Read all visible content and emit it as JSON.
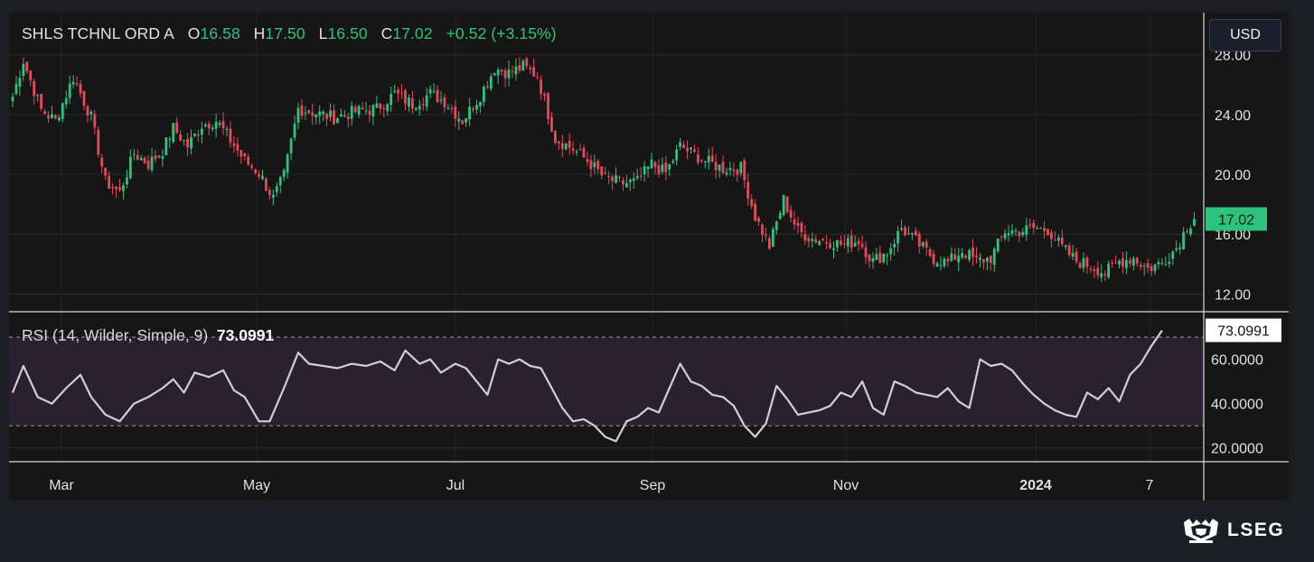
{
  "header": {
    "symbol": "SHLS TCHNL ORD A",
    "open_label": "O",
    "open": "16.58",
    "high_label": "H",
    "high": "17.50",
    "low_label": "L",
    "low": "16.50",
    "close_label": "C",
    "close": "17.02",
    "change": "+0.52 (+3.15%)"
  },
  "currency_button": "USD",
  "rsi_header": {
    "label": "RSI (14, Wilder, Simple, 9)",
    "value": "73.0991"
  },
  "brand": {
    "name": "LSEG"
  },
  "colors": {
    "up": "#2ec27e",
    "down": "#e8485a",
    "background": "#161616",
    "rsi_band": "#2a2130",
    "rsi_line": "#d0d0d0"
  },
  "chart_data": [
    {
      "type": "candlestick",
      "title": "SHLS TCHNL ORD A",
      "ylim": [
        11,
        28.4
      ],
      "yticks": [
        "28.00",
        "24.00",
        "20.00",
        "16.00",
        "12.00"
      ],
      "last_price_label": "17.02",
      "xticks": [
        "Mar",
        "May",
        "Jul",
        "Sep",
        "Nov",
        "2024",
        "7"
      ],
      "anchors": [
        [
          0,
          25.2
        ],
        [
          3,
          27.6
        ],
        [
          8,
          24.3
        ],
        [
          12,
          23.6
        ],
        [
          17,
          26.5
        ],
        [
          22,
          23.8
        ],
        [
          26,
          19.5
        ],
        [
          30,
          18.8
        ],
        [
          34,
          21.4
        ],
        [
          38,
          20.7
        ],
        [
          42,
          21.6
        ],
        [
          45,
          23.1
        ],
        [
          49,
          21.9
        ],
        [
          53,
          23.3
        ],
        [
          57,
          23.6
        ],
        [
          61,
          22.3
        ],
        [
          65,
          20.9
        ],
        [
          69,
          20.1
        ],
        [
          73,
          18.4
        ],
        [
          76,
          19.9
        ],
        [
          80,
          24.4
        ],
        [
          85,
          24.1
        ],
        [
          90,
          23.8
        ],
        [
          96,
          24.2
        ],
        [
          102,
          24.4
        ],
        [
          107,
          25.4
        ],
        [
          112,
          24.7
        ],
        [
          117,
          25.4
        ],
        [
          121,
          24.9
        ],
        [
          126,
          23.6
        ],
        [
          131,
          25.3
        ],
        [
          135,
          27.1
        ],
        [
          139,
          26.8
        ],
        [
          143,
          27.2
        ],
        [
          147,
          26.6
        ],
        [
          152,
          22.4
        ],
        [
          157,
          21.7
        ],
        [
          162,
          20.7
        ],
        [
          166,
          19.7
        ],
        [
          171,
          19.4
        ],
        [
          175,
          19.5
        ],
        [
          179,
          20.7
        ],
        [
          183,
          20.1
        ],
        [
          187,
          21.9
        ],
        [
          191,
          21.3
        ],
        [
          195,
          20.8
        ],
        [
          199,
          20.4
        ],
        [
          204,
          20.4
        ],
        [
          208,
          17.2
        ],
        [
          212,
          15.2
        ],
        [
          216,
          18.3
        ],
        [
          220,
          16.2
        ],
        [
          224,
          15.7
        ],
        [
          229,
          15.5
        ],
        [
          233,
          15.3
        ],
        [
          237,
          15.6
        ],
        [
          241,
          14.2
        ],
        [
          245,
          14.8
        ],
        [
          249,
          16.4
        ],
        [
          253,
          15.5
        ],
        [
          258,
          14.4
        ],
        [
          262,
          14.1
        ],
        [
          266,
          14.9
        ],
        [
          270,
          14.2
        ],
        [
          274,
          14.4
        ],
        [
          278,
          16.2
        ],
        [
          282,
          16.2
        ],
        [
          286,
          16.4
        ],
        [
          290,
          16.3
        ],
        [
          294,
          15.1
        ],
        [
          298,
          14.2
        ],
        [
          302,
          13.9
        ],
        [
          306,
          13.4
        ],
        [
          310,
          14.2
        ],
        [
          314,
          14.4
        ],
        [
          318,
          13.7
        ],
        [
          322,
          14.1
        ],
        [
          326,
          15.1
        ],
        [
          329,
          16.5
        ],
        [
          331,
          17.0
        ]
      ],
      "series": [
        {
          "open": 16.58,
          "high": 17.5,
          "low": 16.5,
          "close": 17.02
        }
      ]
    },
    {
      "type": "line",
      "title": "RSI (14, Wilder, Simple, 9)",
      "ylim": [
        15,
        77
      ],
      "yticks": [
        "60.0000",
        "40.0000",
        "20.0000"
      ],
      "last_value_label": "73.0991",
      "bands": [
        30,
        70
      ],
      "series": [
        {
          "name": "RSI",
          "points": [
            [
              0,
              45
            ],
            [
              3,
              57
            ],
            [
              7,
              43
            ],
            [
              11,
              40
            ],
            [
              15,
              47
            ],
            [
              19,
              53
            ],
            [
              22,
              43
            ],
            [
              26,
              35
            ],
            [
              30,
              32
            ],
            [
              34,
              40
            ],
            [
              38,
              43
            ],
            [
              42,
              47
            ],
            [
              45,
              51
            ],
            [
              48,
              45
            ],
            [
              51,
              54
            ],
            [
              55,
              52
            ],
            [
              59,
              55
            ],
            [
              62,
              46
            ],
            [
              65,
              43
            ],
            [
              69,
              32
            ],
            [
              72,
              32
            ],
            [
              76,
              47
            ],
            [
              80,
              63
            ],
            [
              83,
              58
            ],
            [
              87,
              57
            ],
            [
              91,
              56
            ],
            [
              95,
              58
            ],
            [
              99,
              57
            ],
            [
              103,
              59
            ],
            [
              107,
              55
            ],
            [
              110,
              64
            ],
            [
              114,
              58
            ],
            [
              117,
              60
            ],
            [
              120,
              54
            ],
            [
              124,
              58
            ],
            [
              127,
              56
            ],
            [
              130,
              50
            ],
            [
              133,
              44
            ],
            [
              136,
              60
            ],
            [
              139,
              58
            ],
            [
              142,
              60
            ],
            [
              145,
              57
            ],
            [
              148,
              56
            ],
            [
              151,
              47
            ],
            [
              154,
              38
            ],
            [
              157,
              32
            ],
            [
              160,
              33
            ],
            [
              163,
              30
            ],
            [
              166,
              25
            ],
            [
              169,
              23
            ],
            [
              172,
              32
            ],
            [
              175,
              34
            ],
            [
              178,
              38
            ],
            [
              181,
              36
            ],
            [
              184,
              47
            ],
            [
              187,
              58
            ],
            [
              190,
              50
            ],
            [
              193,
              48
            ],
            [
              196,
              44
            ],
            [
              199,
              43
            ],
            [
              202,
              39
            ],
            [
              205,
              30
            ],
            [
              208,
              25
            ],
            [
              211,
              31
            ],
            [
              214,
              48
            ],
            [
              217,
              42
            ],
            [
              220,
              35
            ],
            [
              223,
              36
            ],
            [
              226,
              37
            ],
            [
              229,
              39
            ],
            [
              232,
              45
            ],
            [
              235,
              43
            ],
            [
              238,
              50
            ],
            [
              241,
              38
            ],
            [
              244,
              35
            ],
            [
              247,
              50
            ],
            [
              250,
              48
            ],
            [
              253,
              45
            ],
            [
              256,
              44
            ],
            [
              259,
              43
            ],
            [
              262,
              47
            ],
            [
              265,
              41
            ],
            [
              268,
              38
            ],
            [
              271,
              60
            ],
            [
              274,
              57
            ],
            [
              277,
              58
            ],
            [
              280,
              55
            ],
            [
              283,
              49
            ],
            [
              286,
              44
            ],
            [
              289,
              40
            ],
            [
              292,
              37
            ],
            [
              295,
              35
            ],
            [
              298,
              34
            ],
            [
              301,
              45
            ],
            [
              304,
              42
            ],
            [
              307,
              47
            ],
            [
              310,
              41
            ],
            [
              313,
              53
            ],
            [
              316,
              58
            ],
            [
              319,
              66
            ],
            [
              322,
              73
            ]
          ]
        }
      ]
    }
  ]
}
